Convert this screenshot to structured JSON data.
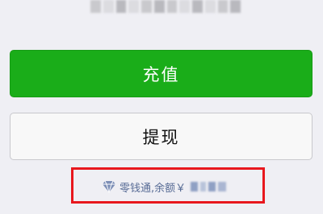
{
  "actions": {
    "recharge_label": "充值",
    "withdraw_label": "提现"
  },
  "balance": {
    "icon": "diamond-icon",
    "label": "零钱通,余额￥",
    "text_color": "#576b95",
    "highlight_color": "#e8171d"
  },
  "colors": {
    "primary_green": "#1aad19",
    "background": "#efeff4"
  }
}
